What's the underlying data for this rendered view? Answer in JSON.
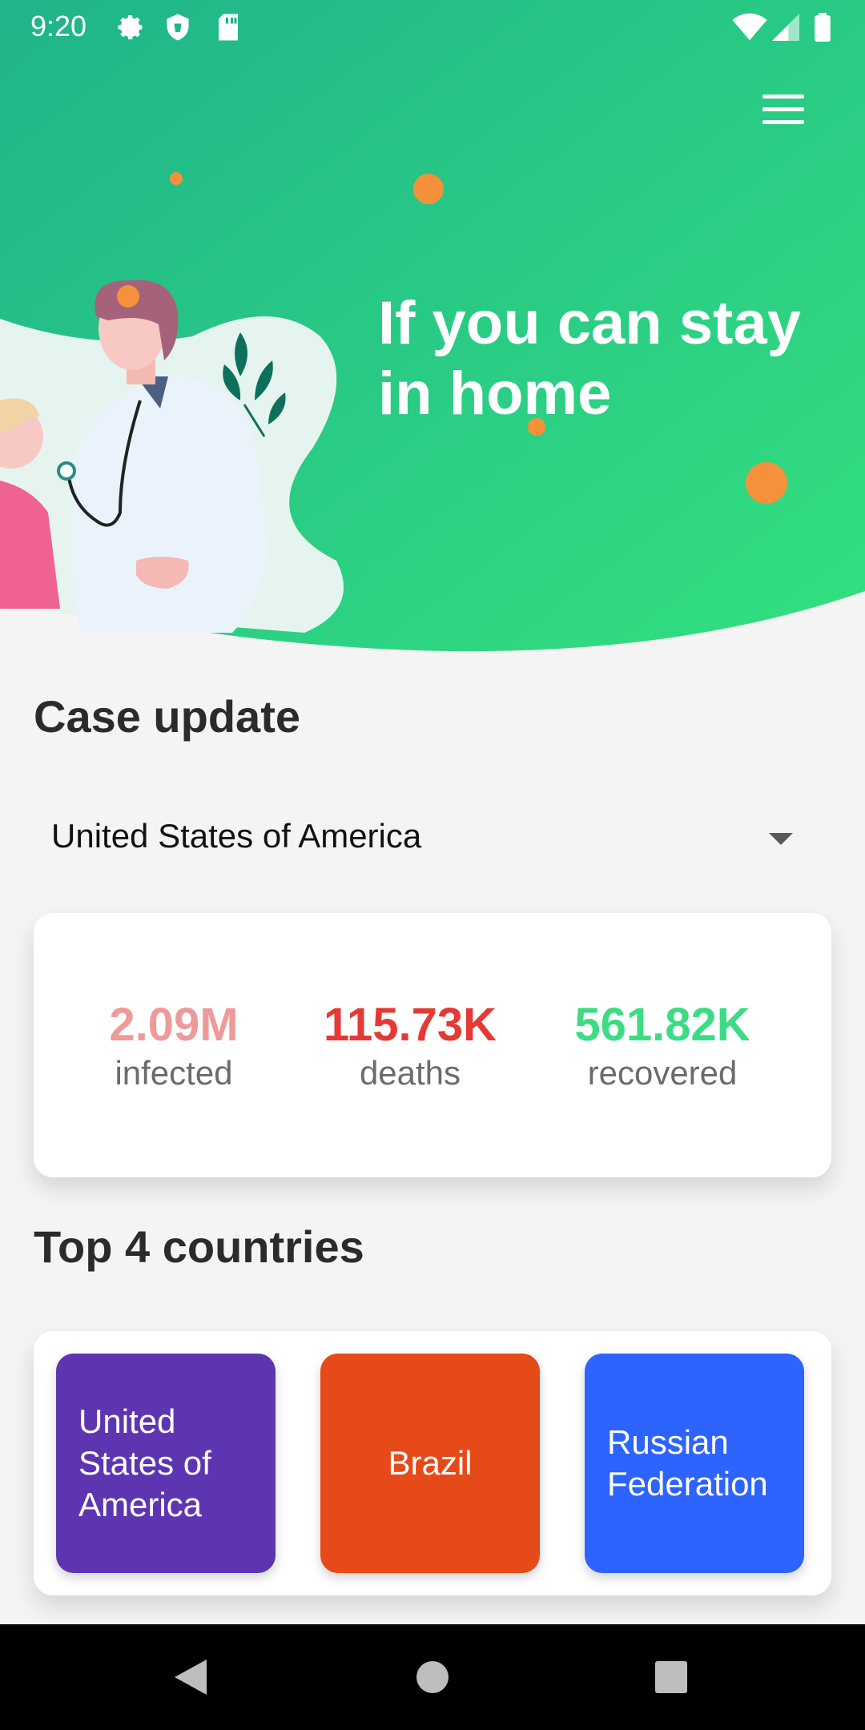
{
  "status_bar": {
    "time": "9:20",
    "left_icons": [
      "settings-icon",
      "shield-icon",
      "sd-card-icon"
    ],
    "right_icons": [
      "wifi-icon",
      "cell-signal-icon",
      "battery-icon"
    ]
  },
  "hero": {
    "headline": "If you can stay in home",
    "gradient": [
      "#1fb48a",
      "#33e07f"
    ],
    "virus_color": "#f5913a"
  },
  "case_update": {
    "title": "Case update",
    "selected_country": "United States of America",
    "stats": [
      {
        "value": "2.09M",
        "label": "infected",
        "color": "#ef9a9a"
      },
      {
        "value": "115.73K",
        "label": "deaths",
        "color": "#e53935"
      },
      {
        "value": "561.82K",
        "label": "recovered",
        "color": "#3ddc84"
      }
    ]
  },
  "top_countries": {
    "title": "Top 4 countries",
    "countries": [
      {
        "name": "United States of America",
        "color": "#5e35b1"
      },
      {
        "name": "Brazil",
        "color": "#e64a19"
      },
      {
        "name": "Russian Federation",
        "color": "#2d63ff"
      }
    ]
  },
  "colors": {
    "background": "#f4f4f4",
    "heading": "#2b2b2b",
    "nav_bar": "#000000"
  }
}
